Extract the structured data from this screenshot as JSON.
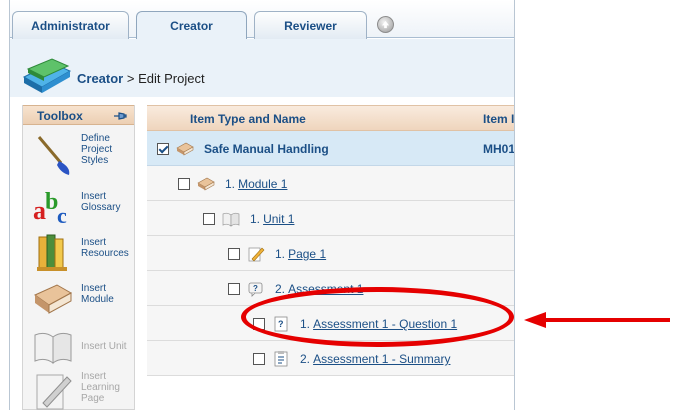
{
  "tabs": [
    {
      "label": "Administrator",
      "active": false
    },
    {
      "label": "Creator",
      "active": true
    },
    {
      "label": "Reviewer",
      "active": false
    }
  ],
  "header": {
    "app": "Creator",
    "separator": " > ",
    "page": "Edit Project"
  },
  "toolbox": {
    "title": "Toolbox",
    "items": [
      {
        "label_lines": [
          "Define",
          "Project",
          "Styles"
        ],
        "icon": "brush-icon",
        "enabled": true
      },
      {
        "label_lines": [
          "Insert",
          "Glossary"
        ],
        "icon": "abc-icon",
        "enabled": true
      },
      {
        "label_lines": [
          "Insert",
          "Resources"
        ],
        "icon": "folders-icon",
        "enabled": true
      },
      {
        "label_lines": [
          "Insert",
          "Module"
        ],
        "icon": "book-closed-icon",
        "enabled": true
      },
      {
        "label_lines": [
          "Insert Unit"
        ],
        "icon": "book-open-icon",
        "enabled": false
      },
      {
        "label_lines": [
          "Insert",
          "Learning",
          "Page"
        ],
        "icon": "pencil-page-icon",
        "enabled": false
      }
    ]
  },
  "grid": {
    "columns": [
      "Item Type and Name",
      "Item ID"
    ],
    "rows": [
      {
        "name": "Safe Manual Handling",
        "number": "",
        "id": "MH01",
        "level": 0,
        "icon": "book-closed-icon",
        "checked": true,
        "selected": true,
        "link": false
      },
      {
        "number": "1.",
        "name": "Module 1",
        "id": "",
        "level": 1,
        "icon": "book-closed-icon",
        "checked": false,
        "selected": false,
        "link": true
      },
      {
        "number": "1.",
        "name": "Unit 1",
        "id": "",
        "level": 2,
        "icon": "book-open-icon",
        "checked": false,
        "selected": false,
        "link": true
      },
      {
        "number": "1.",
        "name": "Page 1",
        "id": "",
        "level": 3,
        "icon": "pencil-page-icon",
        "checked": false,
        "selected": false,
        "link": true
      },
      {
        "number": "2.",
        "name": "Assessment 1",
        "id": "",
        "level": 3,
        "icon": "question-bubble-icon",
        "checked": false,
        "selected": false,
        "link": true
      },
      {
        "number": "1.",
        "name": "Assessment 1 - Question 1",
        "id": "",
        "level": 4,
        "icon": "question-page-icon",
        "checked": false,
        "selected": false,
        "link": true
      },
      {
        "number": "2.",
        "name": "Assessment 1 - Summary",
        "id": "",
        "level": 4,
        "icon": "summary-page-icon",
        "checked": false,
        "selected": false,
        "link": true
      }
    ]
  },
  "colors": {
    "accent": "#1b4f86",
    "highlight": "#e50000",
    "selected_row": "#d7e9f6"
  }
}
